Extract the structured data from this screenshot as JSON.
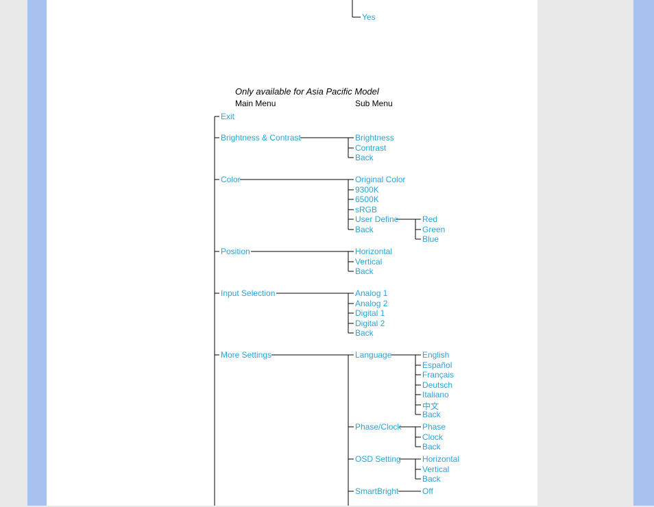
{
  "fragment_top": {
    "item": "Yes"
  },
  "note": "Only available for Asia Pacific Model",
  "headers": {
    "main": "Main Menu",
    "sub": "Sub Menu"
  },
  "menu": {
    "exit": "Exit",
    "brightness_contrast": {
      "label": "Brightness & Contrast",
      "items": [
        "Brightness",
        "Contrast",
        "Back"
      ]
    },
    "color": {
      "label": "Color",
      "items": [
        "Original Color",
        "9300K",
        "6500K",
        "sRGB",
        "User Define",
        "Back"
      ],
      "user_define_sub": [
        "Red",
        "Green",
        "Blue"
      ]
    },
    "position": {
      "label": "Position",
      "items": [
        "Horizontal",
        "Vertical",
        "Back"
      ]
    },
    "input_selection": {
      "label": "Input Selection",
      "items": [
        "Analog 1",
        "Analog 2",
        "Digital 1",
        "Digital 2",
        "Back"
      ]
    },
    "more_settings": {
      "label": "More Settings",
      "language": {
        "label": "Language",
        "items": [
          "English",
          "Español",
          "Français",
          "Deutsch",
          "Italiano",
          "中文",
          "Back"
        ]
      },
      "phase_clock": {
        "label": "Phase/Clock",
        "items": [
          "Phase",
          "Clock",
          "Back"
        ]
      },
      "osd_setting": {
        "label": "OSD Setting",
        "items": [
          "Horizontal",
          "Vertical",
          "Back"
        ]
      },
      "smart_bright": {
        "label": "SmartBright",
        "items": [
          "Off"
        ]
      }
    }
  }
}
